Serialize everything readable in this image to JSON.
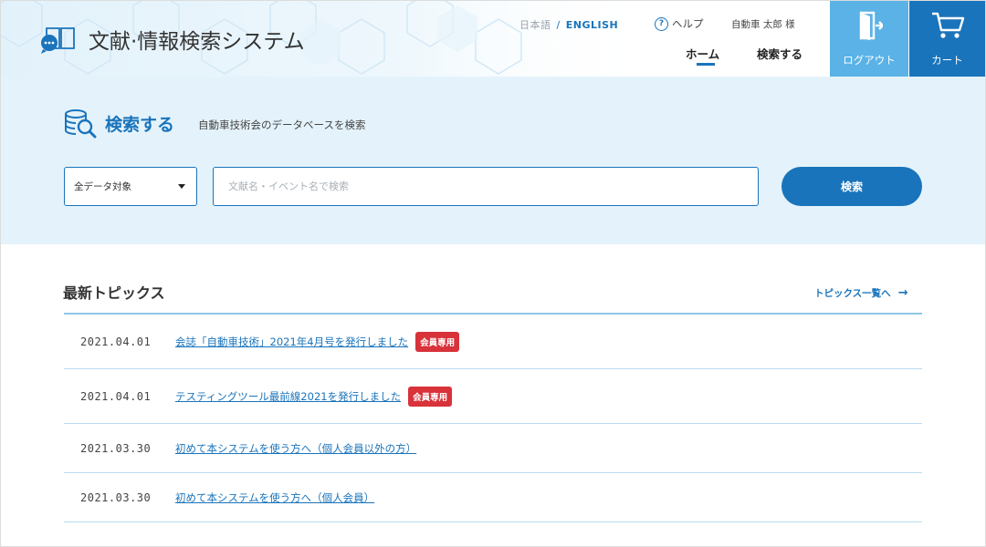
{
  "header": {
    "app_title": "文献·情報検索システム",
    "lang_ja": "日本語",
    "lang_sep": "/",
    "lang_en": "ENGLISH",
    "help_label": "ヘルプ",
    "help_icon": "question-circle-icon",
    "user_name": "自動車 太郎 様",
    "nav": [
      {
        "label": "ホーム",
        "active": true
      },
      {
        "label": "検索する",
        "active": false
      }
    ],
    "logout_label": "ログアウト",
    "logout_icon": "logout-door-icon",
    "cart_label": "カート",
    "cart_icon": "cart-icon",
    "colors": {
      "logout_bg": "#5ab2e6",
      "cart_bg": "#1a74bb"
    }
  },
  "search": {
    "title": "検索する",
    "description": "自動車技術会のデータベースを検索",
    "icon": "database-search-icon",
    "scope_value": "全データ対象",
    "input_placeholder": "文献名・イベント名で検索",
    "input_value": "",
    "button_label": "検索"
  },
  "topics": {
    "title": "最新トピックス",
    "more_label": "トピックス一覧へ",
    "more_icon": "arrow-right-icon",
    "items": [
      {
        "date": "2021.04.01",
        "text": "会誌「自動車技術」2021年4月号を発行しました",
        "badge": "会員専用"
      },
      {
        "date": "2021.04.01",
        "text": "テスティングツール最前線2021を発行しました",
        "badge": "会員専用"
      },
      {
        "date": "2021.03.30",
        "text": "初めて本システムを使う方へ（個人会員以外の方）",
        "badge": ""
      },
      {
        "date": "2021.03.30",
        "text": "初めて本システムを使う方へ（個人会員）",
        "badge": ""
      }
    ]
  },
  "colors": {
    "accent": "#1a74bb",
    "band_bg": "#e4f3fb",
    "badge_red": "#d8323a"
  }
}
